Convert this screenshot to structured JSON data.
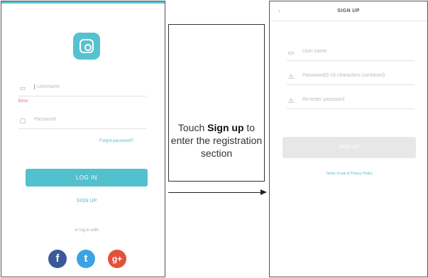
{
  "login_screen": {
    "username_placeholder": "Username",
    "error_text": "Error",
    "password_placeholder": "Password",
    "forgot_link": "Forgot password?",
    "login_button": "LOG IN",
    "signup_link": "SIGN UP",
    "or_login_with": "or log in with",
    "social": {
      "facebook_glyph": "f",
      "twitter_glyph": "t",
      "google_glyph": "g+"
    }
  },
  "callout": {
    "text_before": "Touch ",
    "text_bold": "Sign up",
    "text_after": " to enter the registration section"
  },
  "signup_screen": {
    "back_glyph": "‹",
    "title": "SIGN UP",
    "username_placeholder": "User name",
    "password_placeholder": "Password(6-16 characters combined)",
    "confirm_placeholder": "Re-enter password",
    "signup_button": "SIGN UP",
    "terms_link": "Terms of use & Privacy Policy"
  },
  "colors": {
    "accent": "#52c0cd",
    "facebook": "#3b5998",
    "twitter": "#3aa3e3",
    "google": "#e3513d",
    "disabled_button": "#e7e7e7"
  }
}
